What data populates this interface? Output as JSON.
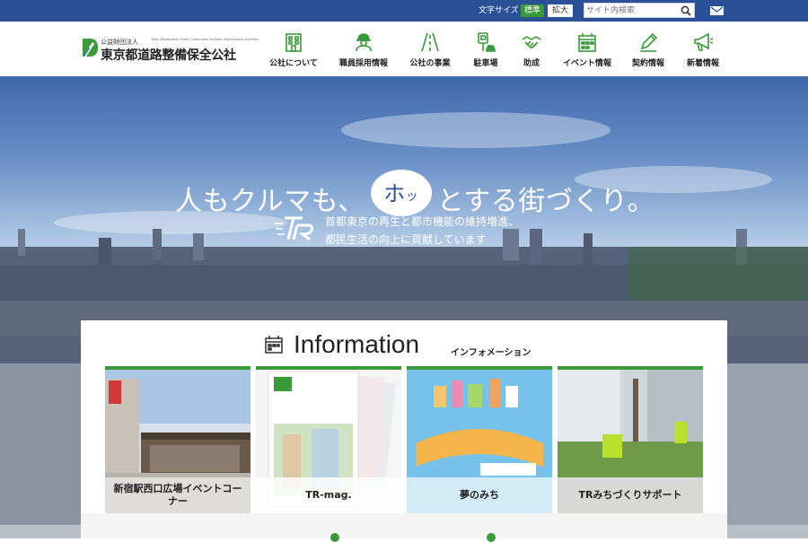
{
  "topbar": {
    "font_size_label": "文字サイズ",
    "font_standard": "標準",
    "font_large": "拡大",
    "search_placeholder": "サイト内検索",
    "search_icon": "search-icon",
    "mail_icon": "mail-icon"
  },
  "header": {
    "logo_sub": "公益財団法人",
    "logo_sub_en": "Tokyo Metropolitan Public Corporation for Road Improvement and Management",
    "logo_main": "東京都道路整備保全公社",
    "nav": [
      {
        "label": "公社について",
        "icon": "building-icon"
      },
      {
        "label": "職員採用情報",
        "icon": "worker-icon"
      },
      {
        "label": "公社の事業",
        "icon": "road-icon"
      },
      {
        "label": "駐車場",
        "icon": "parking-icon"
      },
      {
        "label": "助成",
        "icon": "handshake-icon"
      },
      {
        "label": "イベント情報",
        "icon": "calendar-icon"
      },
      {
        "label": "契約情報",
        "icon": "pen-icon"
      },
      {
        "label": "新着情報",
        "icon": "megaphone-icon"
      }
    ]
  },
  "hero": {
    "title_before": "人もクルマも、",
    "title_bubble": "ホ",
    "title_bubble_small": "ッ",
    "title_after": "とする街づくり。",
    "subtitle_line1": "首都東京の再生と都市機能の維持増進、",
    "subtitle_line2": "都民生活の向上に貢献しています"
  },
  "information": {
    "title": "Information",
    "subtitle": "インフォメーション",
    "cards": [
      {
        "label": "新宿駅西口広場イベントコーナー"
      },
      {
        "label": "TR-mag."
      },
      {
        "label": "夢のみち"
      },
      {
        "label": "TRみちづくりサポート"
      }
    ]
  },
  "colors": {
    "topbar": "#2a5198",
    "accent_green": "#3a9a3a",
    "text": "#222222"
  }
}
